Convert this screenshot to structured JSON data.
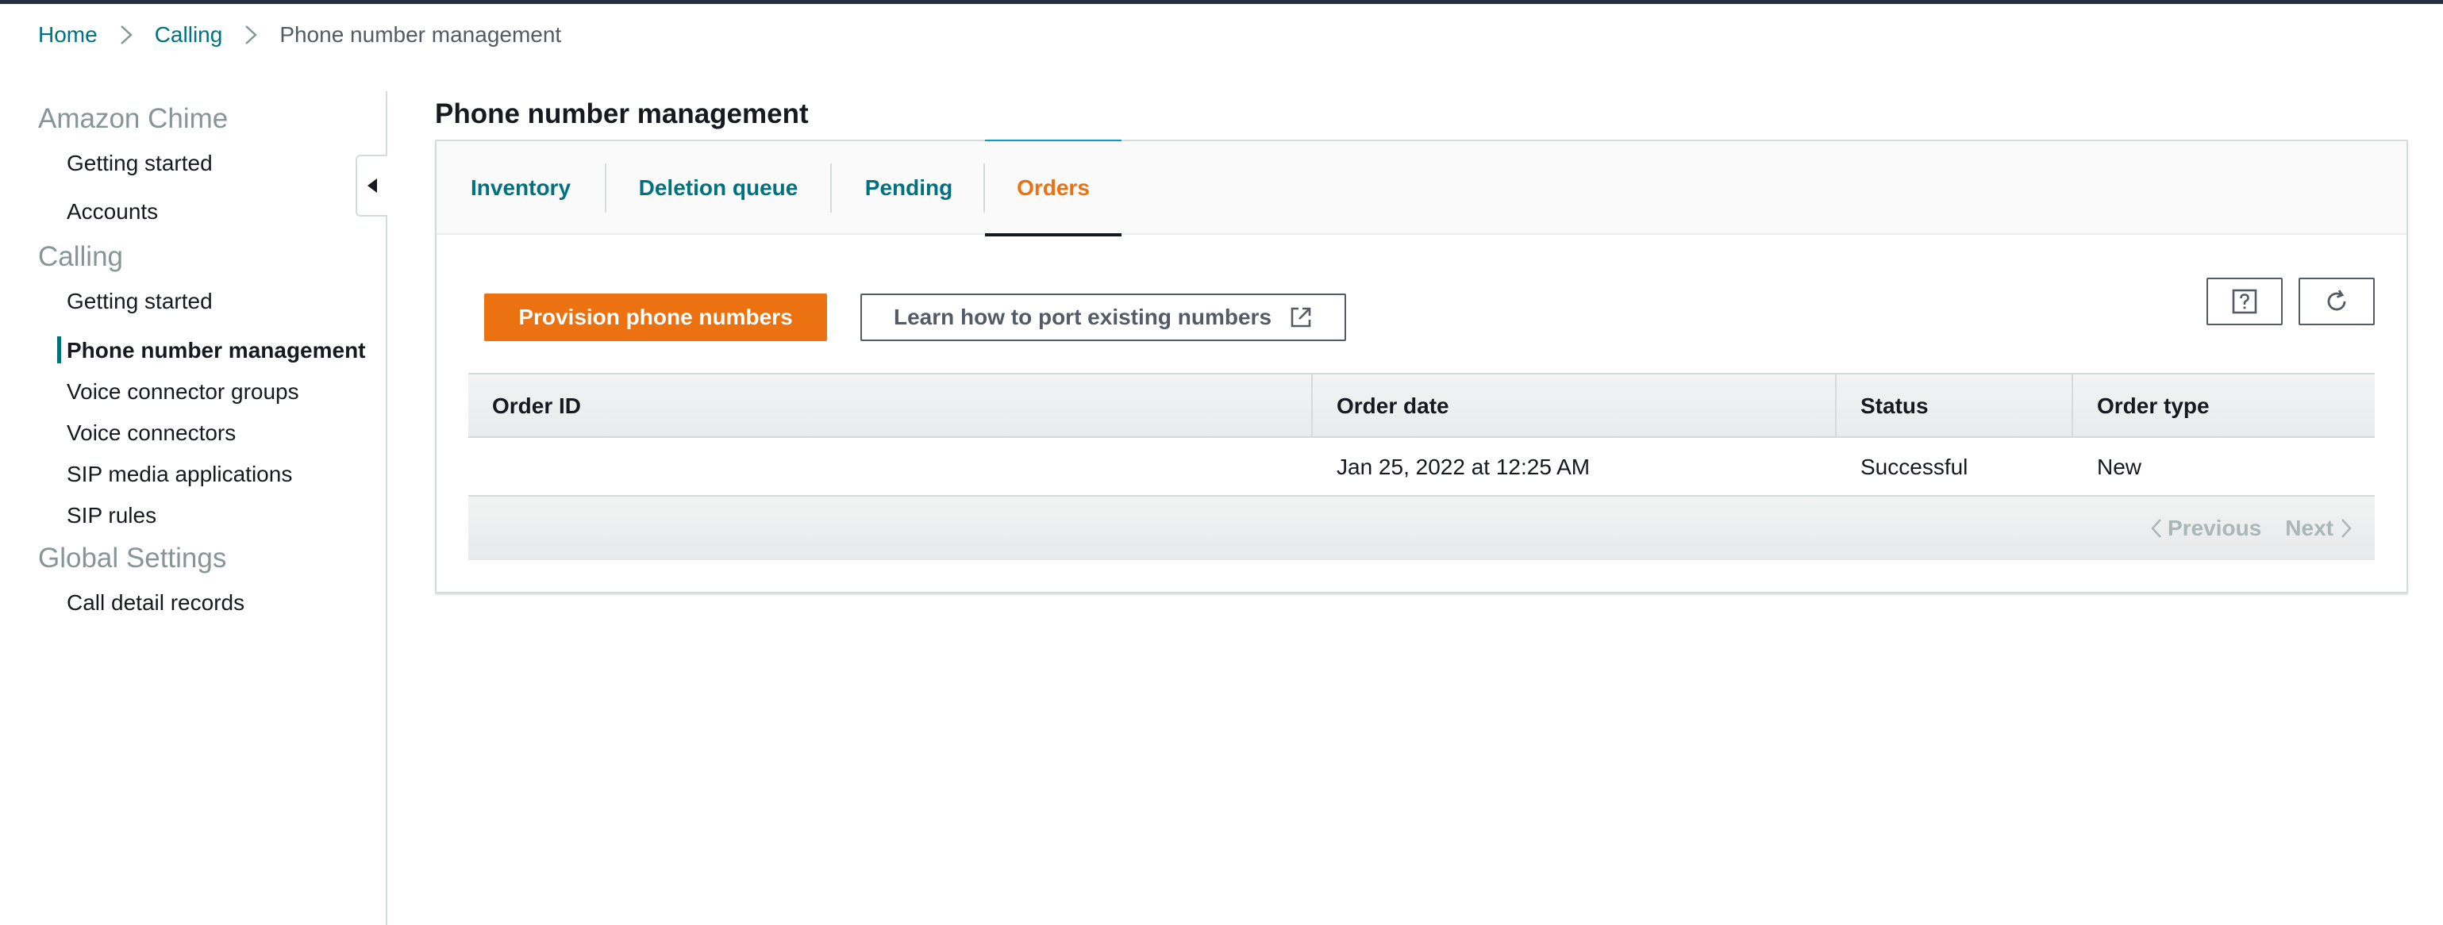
{
  "breadcrumb": {
    "items": [
      "Home",
      "Calling"
    ],
    "current": "Phone number management"
  },
  "sidebar": {
    "sections": [
      {
        "title": "Amazon Chime",
        "items": [
          "Getting started",
          "Accounts"
        ]
      },
      {
        "title": "Calling",
        "items": [
          "Getting started",
          "Phone number management",
          "Voice connector groups",
          "Voice connectors",
          "SIP media applications",
          "SIP rules"
        ]
      },
      {
        "title": "Global Settings",
        "items": [
          "Call detail records"
        ]
      }
    ],
    "active_item": "Phone number management",
    "collapse_icon": "caret-left-icon"
  },
  "page": {
    "title": "Phone number management"
  },
  "tabs": [
    {
      "label": "Inventory",
      "active": false
    },
    {
      "label": "Deletion queue",
      "active": false
    },
    {
      "label": "Pending",
      "active": false
    },
    {
      "label": "Orders",
      "active": true
    }
  ],
  "actions": {
    "provision_label": "Provision phone numbers",
    "learn_label": "Learn how to port existing numbers",
    "learn_icon": "external-link-icon",
    "help_icon": "help-icon",
    "refresh_icon": "refresh-icon"
  },
  "table": {
    "columns": [
      "Order ID",
      "Order date",
      "Status",
      "Order type"
    ],
    "rows": [
      {
        "order_id": "",
        "order_date": "Jan 25, 2022 at 12:25 AM",
        "status": "Successful",
        "order_type": "New"
      }
    ]
  },
  "pagination": {
    "previous_label": "Previous",
    "next_label": "Next"
  },
  "colors": {
    "accent": "#ec7211",
    "link": "#00727e",
    "text": "#16191f",
    "muted": "#879596",
    "border": "#d5dbdb"
  }
}
